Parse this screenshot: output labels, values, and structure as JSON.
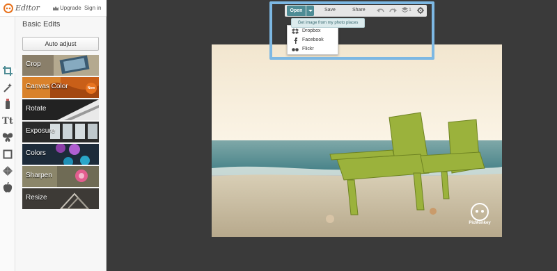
{
  "app": {
    "logo_text": "Editor",
    "upgrade_label": "Upgrade",
    "signin_label": "Sign in"
  },
  "left_panel": {
    "section_title": "Basic Edits",
    "auto_adjust_label": "Auto adjust",
    "tiles": [
      {
        "label": "Crop"
      },
      {
        "label": "Canvas Color",
        "badge": "New"
      },
      {
        "label": "Rotate"
      },
      {
        "label": "Exposure"
      },
      {
        "label": "Colors"
      },
      {
        "label": "Sharpen"
      },
      {
        "label": "Resize"
      }
    ],
    "tools": [
      "crop-icon",
      "magic-wand-icon",
      "brush-icon",
      "text-icon",
      "butterfly-icon",
      "frame-icon",
      "texture-icon",
      "apple-icon"
    ]
  },
  "toolbar": {
    "open_label": "Open",
    "save_label": "Save",
    "share_label": "Share",
    "layers_count": "1",
    "tooltip": "Get image from my photo places",
    "menu_items": [
      {
        "label": "Dropbox",
        "icon": "dropbox-icon"
      },
      {
        "label": "Facebook",
        "icon": "facebook-icon"
      },
      {
        "label": "Flickr",
        "icon": "flickr-icon"
      }
    ]
  },
  "photo": {
    "watermark_text": "PicMonkey"
  },
  "colors": {
    "accent": "#4e8c95",
    "highlight": "#7db8e3",
    "canvas": "#3a3a3a"
  }
}
